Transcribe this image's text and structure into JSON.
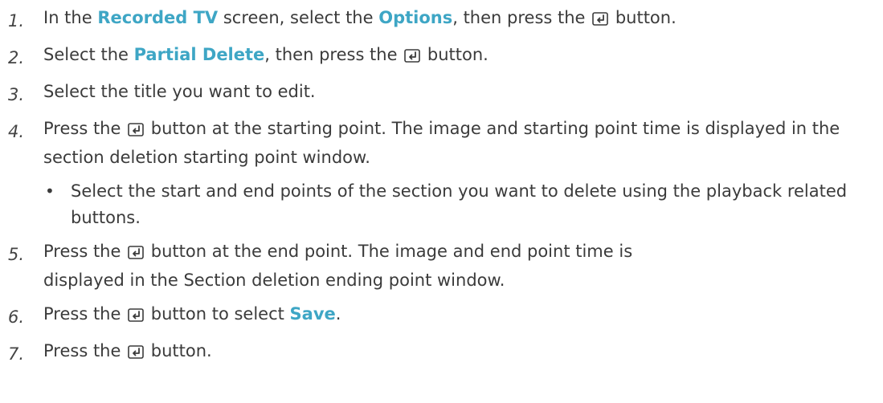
{
  "steps": [
    {
      "num": "1.",
      "parts": [
        {
          "t": "In the ",
          "hl": false
        },
        {
          "t": "Recorded TV",
          "hl": true
        },
        {
          "t": " screen, select the ",
          "hl": false
        },
        {
          "t": "Options",
          "hl": true
        },
        {
          "t": ", then press the ",
          "hl": false
        },
        {
          "icon": "enter-icon"
        },
        {
          "t": " button.",
          "hl": false
        }
      ]
    },
    {
      "num": "2.",
      "parts": [
        {
          "t": "Select the ",
          "hl": false
        },
        {
          "t": "Partial Delete",
          "hl": true
        },
        {
          "t": ", then press the ",
          "hl": false
        },
        {
          "icon": "enter-icon"
        },
        {
          "t": " button.",
          "hl": false
        }
      ]
    },
    {
      "num": "3.",
      "parts": [
        {
          "t": "Select the title you want to edit.",
          "hl": false
        }
      ]
    },
    {
      "num": "4.",
      "parts": [
        {
          "t": "Press the ",
          "hl": false
        },
        {
          "icon": "enter-icon"
        },
        {
          "t": " button at the starting point. The image and starting point time is displayed in the section deletion starting point window.",
          "hl": false
        }
      ],
      "sub": "Select the start and end points of the section you want to delete using the playback related buttons."
    },
    {
      "num": "5.",
      "parts": [
        {
          "t": "Press the ",
          "hl": false
        },
        {
          "icon": "enter-icon"
        },
        {
          "t": " button at the end point. The image and end point time is",
          "hl": false
        },
        {
          "br": true
        },
        {
          "t": "displayed in the Section deletion ending point window.",
          "hl": false
        }
      ]
    },
    {
      "num": "6.",
      "parts": [
        {
          "t": "Press the ",
          "hl": false
        },
        {
          "icon": "enter-icon"
        },
        {
          "t": " button to select ",
          "hl": false
        },
        {
          "t": "Save",
          "hl": true
        },
        {
          "t": ".",
          "hl": false
        }
      ]
    },
    {
      "num": "7.",
      "parts": [
        {
          "t": "Press the ",
          "hl": false
        },
        {
          "icon": "enter-icon"
        },
        {
          "t": " button.",
          "hl": false
        }
      ]
    }
  ],
  "bullet_char": "•",
  "colors": {
    "highlight": "#3ea6c5",
    "text": "#3b3b3b"
  }
}
